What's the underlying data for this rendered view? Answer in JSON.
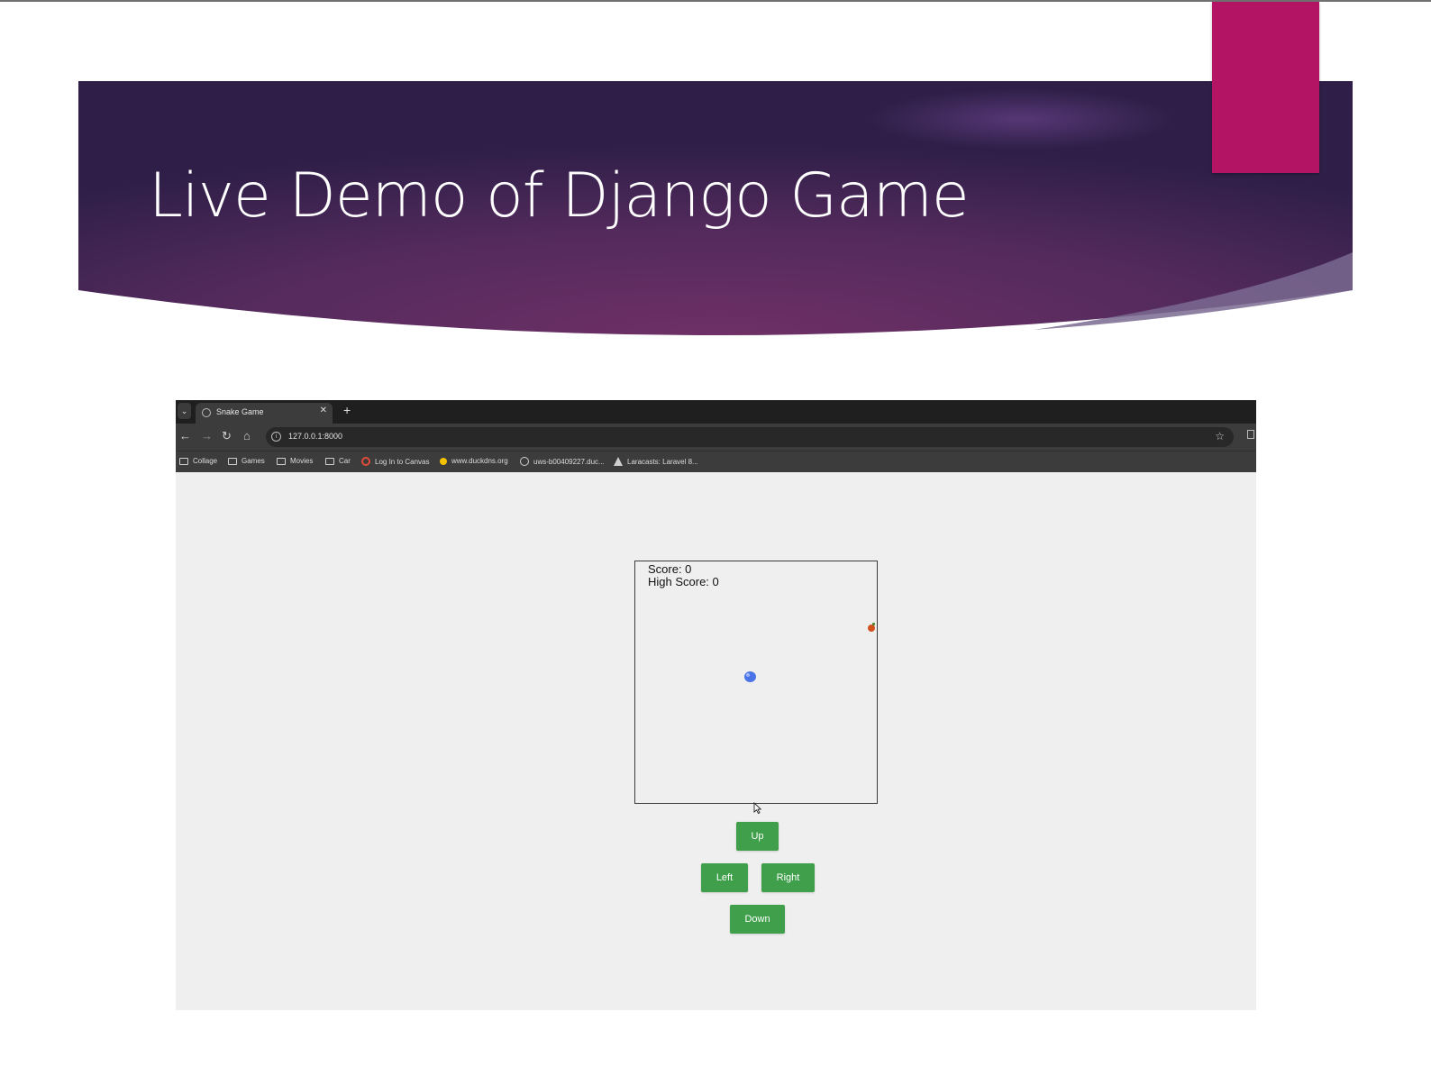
{
  "slide": {
    "title": "Live Demo of Django Game",
    "colors": {
      "banner": "#5a2a5e",
      "accent_tab": "#b31463"
    }
  },
  "browser": {
    "tab": {
      "title": "Snake Game",
      "close_glyph": "✕"
    },
    "new_tab_glyph": "+",
    "tab_menu_glyph": "⌄",
    "address": {
      "url": "127.0.0.1:8000"
    },
    "nav": {
      "back": "←",
      "forward": "→",
      "reload": "↻",
      "home": "⌂",
      "star": "☆"
    },
    "bookmarks": [
      {
        "label": "Collage",
        "icon": "folder-icon"
      },
      {
        "label": "Games",
        "icon": "folder-icon"
      },
      {
        "label": "Movies",
        "icon": "folder-icon"
      },
      {
        "label": "Car",
        "icon": "folder-icon"
      },
      {
        "label": "Log In to Canvas",
        "icon": "canvas-icon"
      },
      {
        "label": "www.duckdns.org",
        "icon": "duck-icon"
      },
      {
        "label": "uws-b00409227.duc...",
        "icon": "globe-icon"
      },
      {
        "label": "Laracasts: Laravel 8...",
        "icon": "laracasts-icon"
      }
    ]
  },
  "game": {
    "score_text": "Score: 0",
    "high_score_text": "High Score: 0",
    "controls": {
      "up": "Up",
      "left": "Left",
      "right": "Right",
      "down": "Down"
    },
    "colors": {
      "button": "#3f9f4a",
      "snake": "#4a74e8",
      "food": "#d2521f"
    }
  }
}
